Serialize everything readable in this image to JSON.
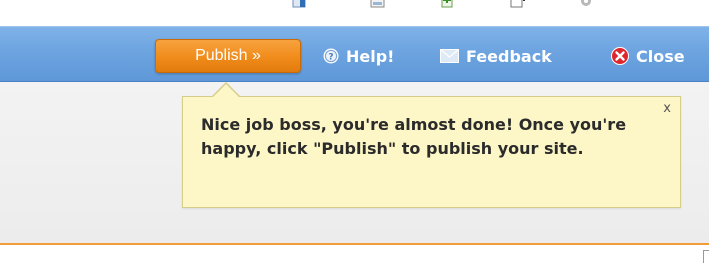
{
  "toolbar": {
    "publish_label": "Publish »",
    "help_label": "Help!",
    "feedback_label": "Feedback",
    "close_label": "Close"
  },
  "tooltip": {
    "message": "Nice job boss, you're almost done! Once you're happy, click \"Publish\" to publish your site.",
    "close_label": "x"
  },
  "icons": {
    "help": "help-circle-icon",
    "feedback": "envelope-icon",
    "close": "close-circle-icon"
  },
  "colors": {
    "toolbar_blue": "#6da4e0",
    "publish_orange": "#f08c1b",
    "tooltip_yellow": "#fdf6c6",
    "close_red": "#e0252c",
    "accent_orange_line": "#f39b3a"
  }
}
